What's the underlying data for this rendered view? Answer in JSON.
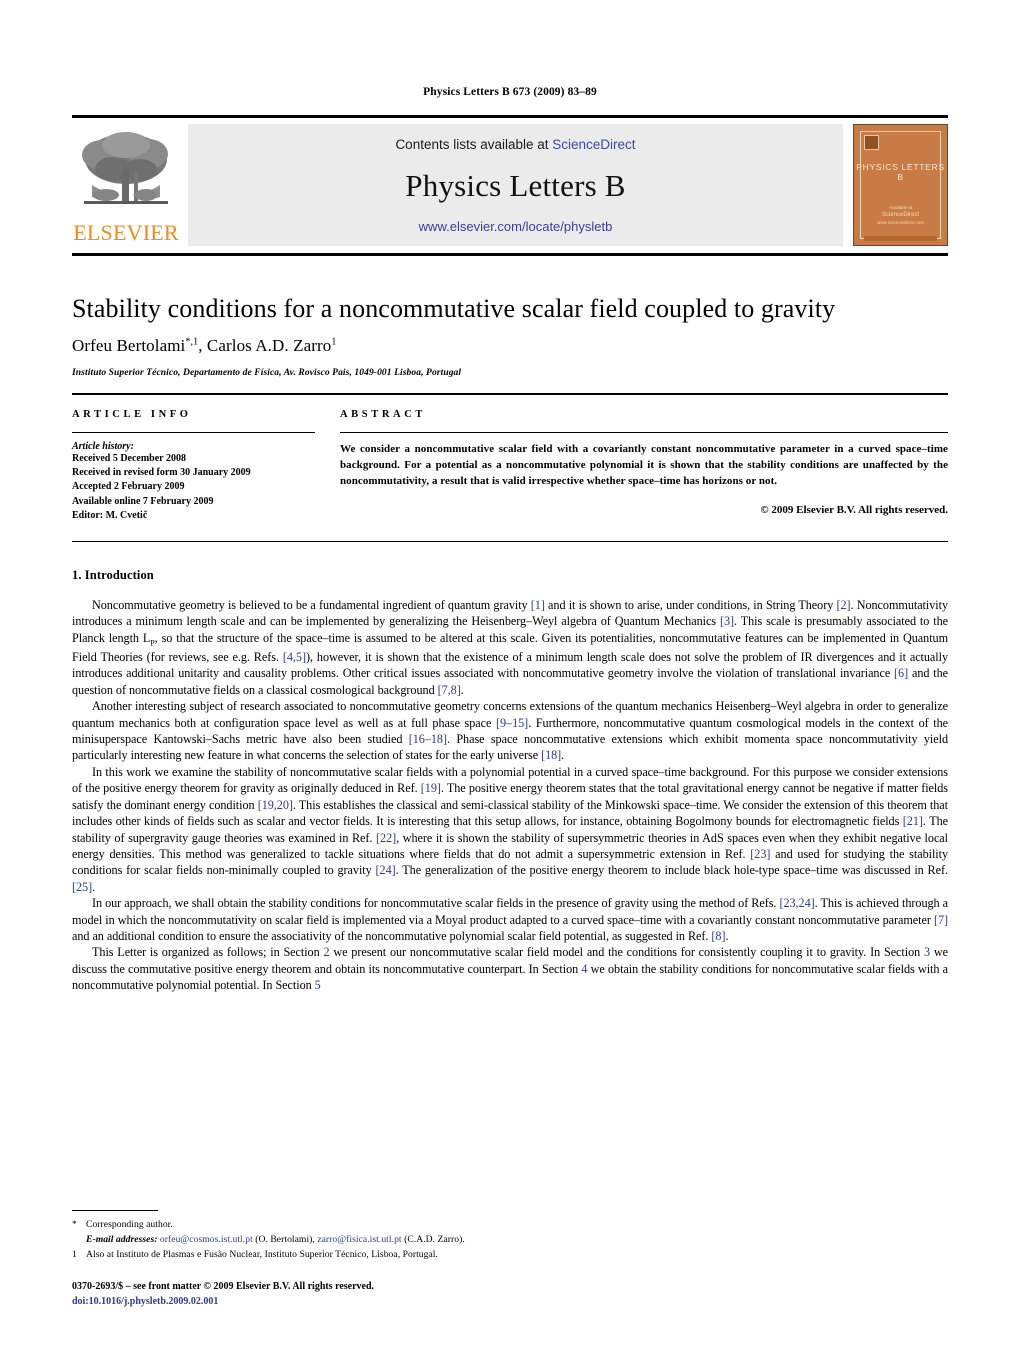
{
  "running_head": "Physics Letters B 673 (2009) 83–89",
  "masthead": {
    "publisher_word": "ELSEVIER",
    "contents_prefix": "Contents lists available at ",
    "sciencedirect": "ScienceDirect",
    "journal_title": "Physics Letters B",
    "journal_url": "www.elsevier.com/locate/physletb",
    "cover": {
      "title": "PHYSICS LETTERS B",
      "foot_small": "Available at",
      "foot_brand": "ScienceDirect",
      "foot_url": "www.sciencedirect.com"
    }
  },
  "article": {
    "title": "Stability conditions for a noncommutative scalar field coupled to gravity",
    "author_1": "Orfeu Bertolami",
    "author_1_marks": "*,1",
    "author_sep": ", ",
    "author_2": "Carlos A.D. Zarro",
    "author_2_marks": "1",
    "affiliation": "Instituto Superior Técnico, Departamento de Física, Av. Rovisco Pais, 1049-001 Lisboa, Portugal"
  },
  "info": {
    "heading": "ARTICLE INFO",
    "history_label": "Article history:",
    "lines": [
      "Received 5 December 2008",
      "Received in revised form 30 January 2009",
      "Accepted 2 February 2009",
      "Available online 7 February 2009",
      "Editor: M. Cvetič"
    ]
  },
  "abstract": {
    "heading": "ABSTRACT",
    "text": "We consider a noncommutative scalar field with a covariantly constant noncommutative parameter in a curved space–time background. For a potential as a noncommutative polynomial it is shown that the stability conditions are unaffected by the noncommutativity, a result that is valid irrespective whether space–time has horizons or not.",
    "copyright": "© 2009 Elsevier B.V. All rights reserved."
  },
  "section": {
    "number_title": "1. Introduction",
    "paragraphs": [
      "Noncommutative geometry is believed to be a fundamental ingredient of quantum gravity [1] and it is shown to arise, under conditions, in String Theory [2]. Noncommutativity introduces a minimum length scale and can be implemented by generalizing the Heisenberg–Weyl algebra of Quantum Mechanics [3]. This scale is presumably associated to the Planck length LP, so that the structure of the space–time is assumed to be altered at this scale. Given its potentialities, noncommutative features can be implemented in Quantum Field Theories (for reviews, see e.g. Refs. [4,5]), however, it is shown that the existence of a minimum length scale does not solve the problem of IR divergences and it actually introduces additional unitarity and causality problems. Other critical issues associated with noncommutative geometry involve the violation of translational invariance [6] and the question of noncommutative fields on a classical cosmological background [7,8].",
      "Another interesting subject of research associated to noncommutative geometry concerns extensions of the quantum mechanics Heisenberg–Weyl algebra in order to generalize quantum mechanics both at configuration space level as well as at full phase space [9–15]. Furthermore, noncommutative quantum cosmological models in the context of the minisuperspace Kantowski–Sachs metric have also been studied [16–18]. Phase space noncommutative extensions which exhibit momenta space noncommutativity yield particularly interesting new feature in what concerns the selection of states for the early universe [18].",
      "In this work we examine the stability of noncommutative scalar fields with a polynomial potential in a curved space–time background. For this purpose we consider extensions of the positive energy theorem for gravity as originally deduced in Ref. [19]. The positive energy theorem states that the total gravitational energy cannot be negative if matter fields satisfy the dominant energy condition [19,20]. This establishes the classical and semi-classical stability of the Minkowski space–time. We consider the extension of this theorem that includes other kinds of fields such as scalar and vector fields. It is interesting that this setup allows, for instance, obtaining Bogolmony bounds for electromagnetic fields [21]. The stability of supergravity gauge theories was examined in Ref. [22], where it is shown the stability of supersymmetric theories in AdS spaces even when they exhibit negative local energy densities. This method was generalized to tackle situations where fields that do not admit a supersymmetric extension in Ref. [23] and used for studying the stability conditions for scalar fields non-minimally coupled to gravity [24]. The generalization of the positive energy theorem to include black hole-type space–time was discussed in Ref. [25].",
      "In our approach, we shall obtain the stability conditions for noncommutative scalar fields in the presence of gravity using the method of Refs. [23,24]. This is achieved through a model in which the noncommutativity on scalar field is implemented via a Moyal product adapted to a curved space–time with a covariantly constant noncommutative parameter [7] and an additional condition to ensure the associativity of the noncommutative polynomial scalar field potential, as suggested in Ref. [8].",
      "This Letter is organized as follows; in Section 2 we present our noncommutative scalar field model and the conditions for consistently coupling it to gravity. In Section 3 we discuss the commutative positive energy theorem and obtain its noncommutative counterpart. In Section 4 we obtain the stability conditions for noncommutative scalar fields with a noncommutative polynomial potential. In Section 5"
    ]
  },
  "footnotes": {
    "corresponding_mark": "*",
    "corresponding_text": "Corresponding author.",
    "email_label": "E-mail addresses:",
    "email_1": "orfeu@cosmos.ist.utl.pt",
    "email_1_owner": " (O. Bertolami), ",
    "email_2": "zarro@fisica.ist.utl.pt",
    "email_2_owner": " (C.A.D. Zarro).",
    "note_mark": "1",
    "note_text": "Also at Instituto de Plasmas e Fusão Nuclear, Instituto Superior Técnico, Lisboa, Portugal.",
    "issn_line": "0370-2693/$ – see front matter © 2009 Elsevier B.V. All rights reserved.",
    "doi_line": "doi:10.1016/j.physletb.2009.02.001"
  },
  "colors": {
    "link_blue": "#2c3b8f",
    "elsevier_orange": "#f08a1a",
    "banner_grey": "#ebebeb",
    "cover_orange": "#c97b45"
  }
}
